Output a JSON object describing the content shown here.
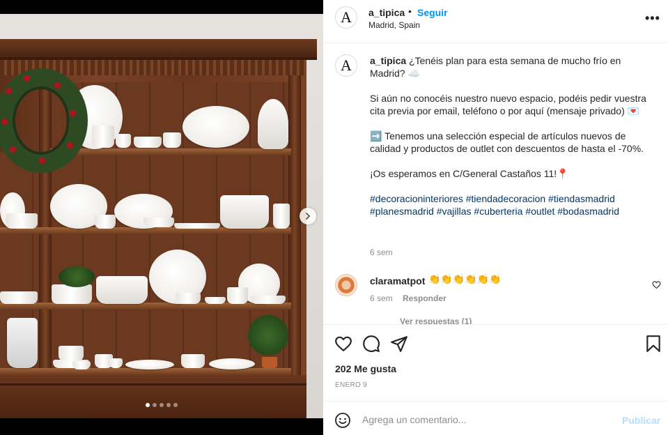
{
  "post": {
    "username": "a_tipica",
    "avatar_letter": "A",
    "follow_separator": "•",
    "follow_label": "Seguir",
    "location": "Madrid, Spain",
    "more_label": "•••"
  },
  "caption": {
    "username": "a_tipica",
    "line1": "¿Tenéis plan para esta semana de mucho frío en Madrid? ☁️",
    "line2": "Si aún no conocéis nuestro nuevo espacio, podéis pedir vuestra cita previa por email, teléfono o por aquí (mensaje privado) 💌",
    "line3": "➡️ Tenemos una selección especial de artículos nuevos de calidad y productos de outlet con descuentos de hasta el -70%.",
    "line4": "¡Os esperamos en C/General Castaños 11!📍",
    "hashtags": "#decoracioninteriores #tiendadecoracion #tiendasmadrid #planesmadrid #vajillas #cuberteria #outlet #bodasmadrid",
    "time": "6 sem"
  },
  "comment": {
    "username": "claramatpot",
    "text": "👏👏👏👏👏👏",
    "time": "6 sem",
    "reply_label": "Responder",
    "view_replies": "Ver respuestas (1)"
  },
  "stats": {
    "likes": "202 Me gusta",
    "date": "ENERO 9"
  },
  "composer": {
    "placeholder": "Agrega un comentario...",
    "publish_label": "Publicar"
  },
  "carousel": {
    "total": 5,
    "active": 1
  },
  "icons": {
    "like": "heart-icon",
    "comment": "comment-icon",
    "share": "share-icon",
    "save": "bookmark-icon",
    "emoji": "emoji-icon",
    "next": "chevron-right-icon"
  },
  "colors": {
    "follow": "#0095f6",
    "hashtag": "#00376b",
    "muted": "#8e8e8e",
    "publish_disabled": "#b2dffc"
  }
}
